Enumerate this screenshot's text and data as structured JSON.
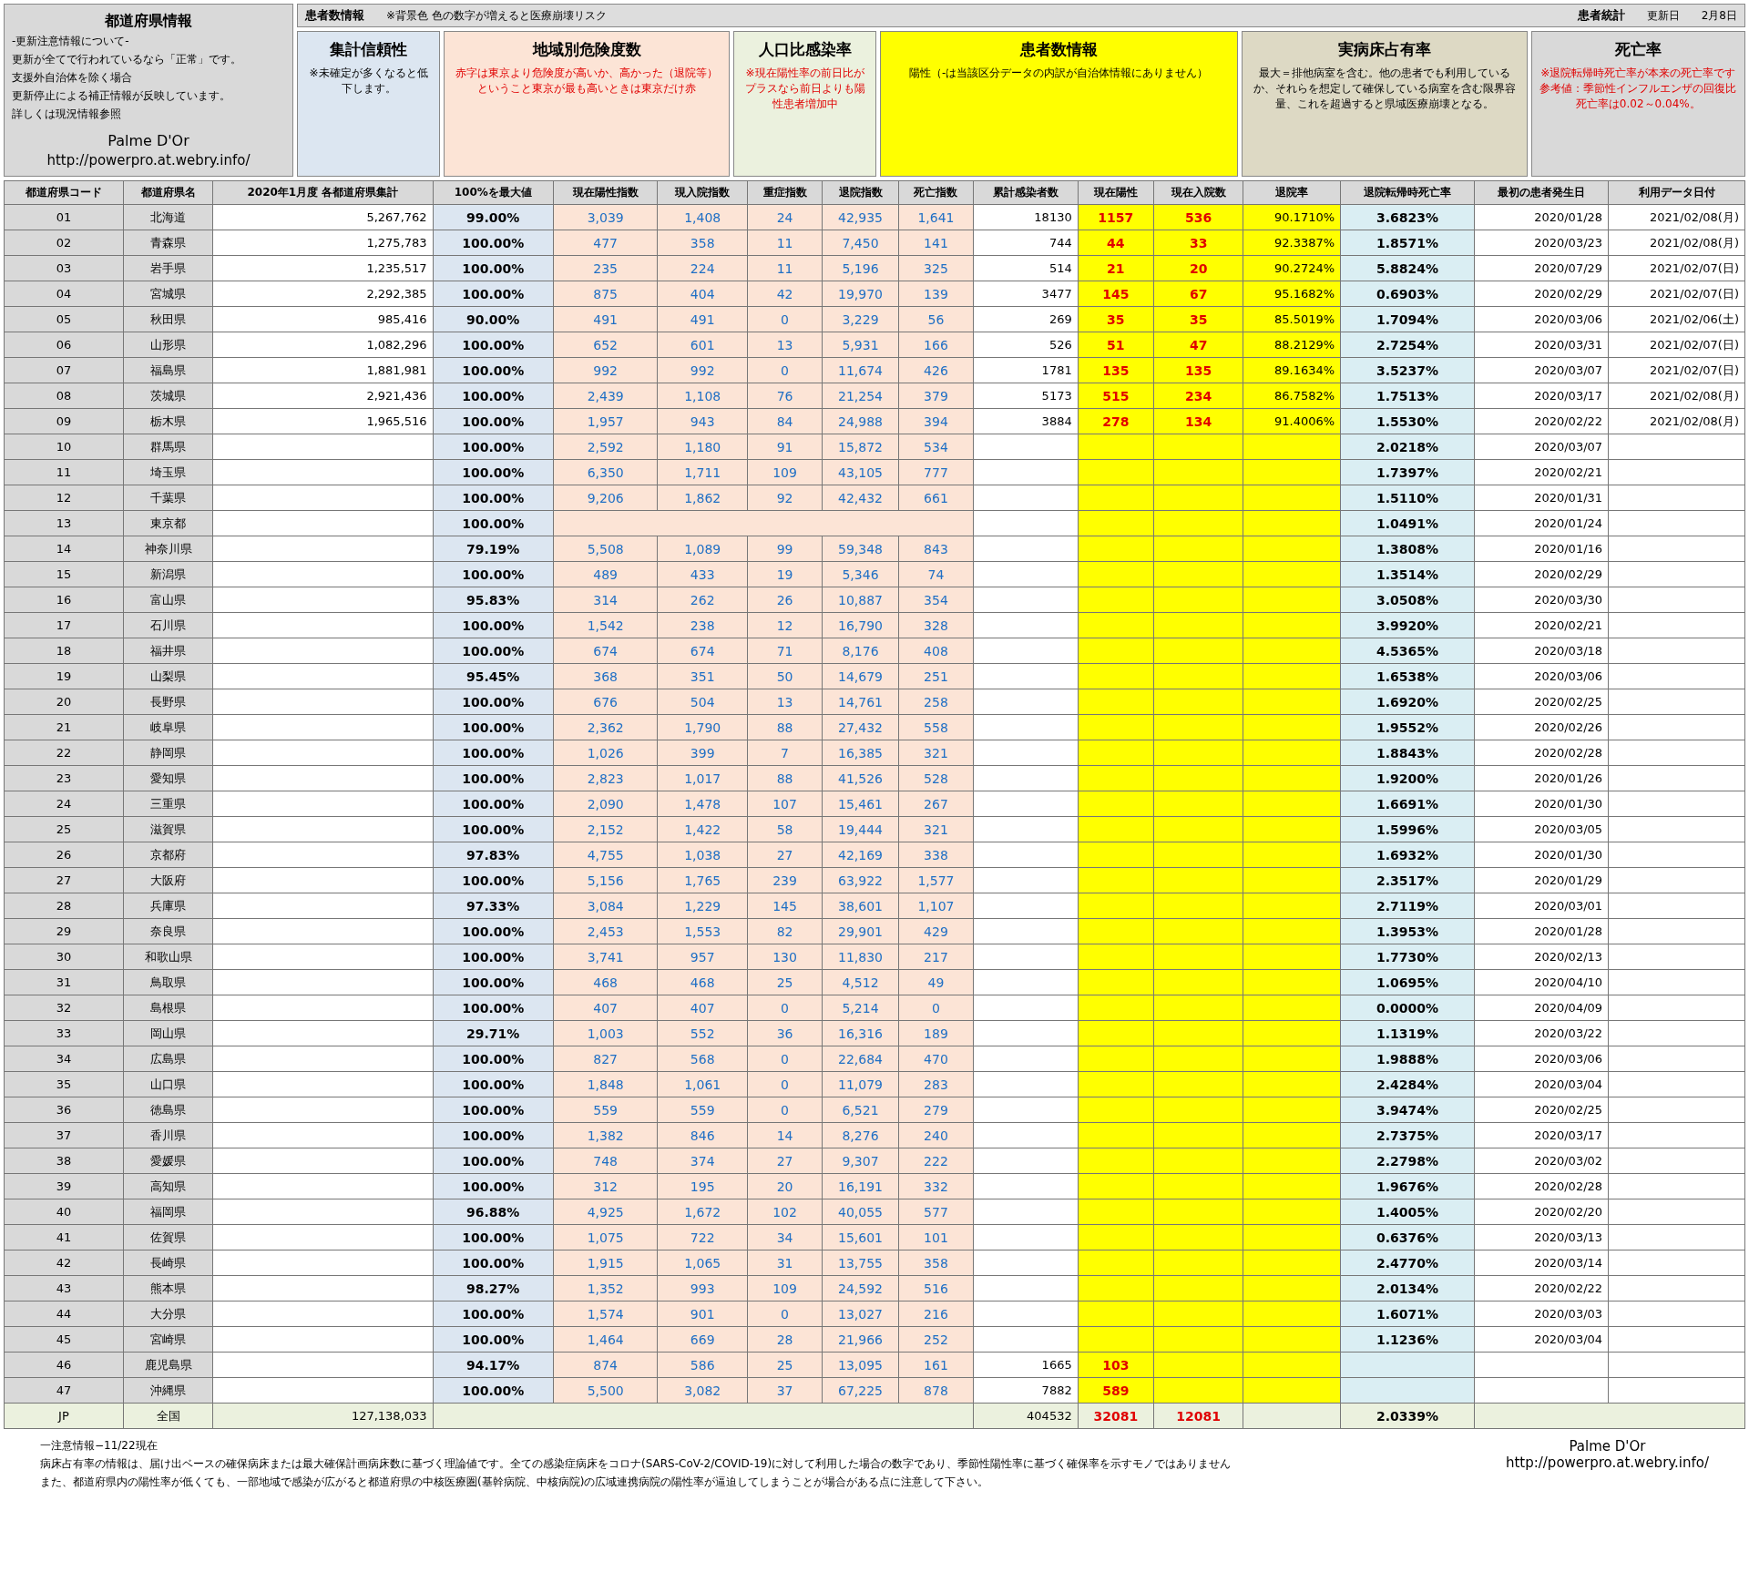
{
  "header": {
    "left_title": "都道府県情報",
    "notes": [
      "-更新注意情報について-",
      "更新が全てで行われているなら「正常」です。",
      "支援外自治体を除く場合",
      "更新停止による補正情報が反映しています。",
      "詳しくは現況情報参照"
    ],
    "brand": "Palme D'Or",
    "url": "http://powerpro.at.webry.info/",
    "center_title": "患者数情報",
    "center_note": "※背景色 色の数字が増えると医療崩壊リスク",
    "right_title": "患者統計",
    "update_label": "更新日",
    "update_date": "2月8日"
  },
  "groups": [
    {
      "label": "集計信頼性",
      "note": "※未確定が多くなると低下します。"
    },
    {
      "label": "地域別危険度数",
      "note": "赤字は東京より危険度が高いか、高かった（退院等）ということ東京が最も高いときは東京だけ赤"
    },
    {
      "label": "人口比感染率",
      "note": "※現在陽性率の前日比がプラスなら前日よりも陽性患者増加中"
    },
    {
      "label": "患者数情報",
      "note": "陽性（-は当該区分データの内訳が自治体情報にありません）"
    },
    {
      "label": "実病床占有率",
      "note": "最大＝排他病室を含む。他の患者でも利用しているか、それらを想定して確保している病室を含む限界容量、これを超過すると県域医療崩壊となる。"
    },
    {
      "label": "死亡率",
      "note": "※退院転帰時死亡率が本来の死亡率です参考値：季節性インフルエンザの回復比死亡率は0.02～0.04%。"
    }
  ],
  "columns": [
    "都道府県コード",
    "都道府県名",
    "2020年1月度 各都道府県集計",
    "100%を最大値",
    "現在陽性指数",
    "現入院指数",
    "重症指数",
    "退院指数",
    "死亡指数",
    "累計感染者数",
    "現在陽性",
    "現在入院数",
    "退院率",
    "退院転帰時死亡率",
    "最初の患者発生日",
    "利用データ日付"
  ],
  "rows": [
    {
      "code": "01",
      "name": "北海道",
      "population": "5,267,762",
      "reliability": "99.00%",
      "indices": [
        "3,039",
        "1,408",
        "24",
        "42,935",
        "1,641"
      ],
      "cumulative": "18130",
      "positive": "1157",
      "hospitalized": "536",
      "discharge_rate": "90.1710%",
      "death_rate": "3.6823%",
      "first_case": "2020/01/28",
      "data_date": "2021/02/08(月)"
    },
    {
      "code": "02",
      "name": "青森県",
      "population": "1,275,783",
      "reliability": "100.00%",
      "indices": [
        "477",
        "358",
        "11",
        "7,450",
        "141"
      ],
      "cumulative": "744",
      "positive": "44",
      "hospitalized": "33",
      "discharge_rate": "92.3387%",
      "death_rate": "1.8571%",
      "first_case": "2020/03/23",
      "data_date": "2021/02/08(月)"
    },
    {
      "code": "03",
      "name": "岩手県",
      "population": "1,235,517",
      "reliability": "100.00%",
      "indices": [
        "235",
        "224",
        "11",
        "5,196",
        "325"
      ],
      "cumulative": "514",
      "positive": "21",
      "hospitalized": "20",
      "discharge_rate": "90.2724%",
      "death_rate": "5.8824%",
      "first_case": "2020/07/29",
      "data_date": "2021/02/07(日)"
    },
    {
      "code": "04",
      "name": "宮城県",
      "population": "2,292,385",
      "reliability": "100.00%",
      "indices": [
        "875",
        "404",
        "42",
        "19,970",
        "139"
      ],
      "cumulative": "3477",
      "positive": "145",
      "hospitalized": "67",
      "discharge_rate": "95.1682%",
      "death_rate": "0.6903%",
      "first_case": "2020/02/29",
      "data_date": "2021/02/07(日)"
    },
    {
      "code": "05",
      "name": "秋田県",
      "population": "985,416",
      "reliability": "90.00%",
      "indices": [
        "491",
        "491",
        "0",
        "3,229",
        "56"
      ],
      "cumulative": "269",
      "positive": "35",
      "hospitalized": "35",
      "discharge_rate": "85.5019%",
      "death_rate": "1.7094%",
      "first_case": "2020/03/06",
      "data_date": "2021/02/06(土)"
    },
    {
      "code": "06",
      "name": "山形県",
      "population": "1,082,296",
      "reliability": "100.00%",
      "indices": [
        "652",
        "601",
        "13",
        "5,931",
        "166"
      ],
      "cumulative": "526",
      "positive": "51",
      "hospitalized": "47",
      "discharge_rate": "88.2129%",
      "death_rate": "2.7254%",
      "first_case": "2020/03/31",
      "data_date": "2021/02/07(日)"
    },
    {
      "code": "07",
      "name": "福島県",
      "population": "1,881,981",
      "reliability": "100.00%",
      "indices": [
        "992",
        "992",
        "0",
        "11,674",
        "426"
      ],
      "cumulative": "1781",
      "positive": "135",
      "hospitalized": "135",
      "discharge_rate": "89.1634%",
      "death_rate": "3.5237%",
      "first_case": "2020/03/07",
      "data_date": "2021/02/07(日)"
    },
    {
      "code": "08",
      "name": "茨城県",
      "population": "2,921,436",
      "reliability": "100.00%",
      "indices": [
        "2,439",
        "1,108",
        "76",
        "21,254",
        "379"
      ],
      "cumulative": "5173",
      "positive": "515",
      "hospitalized": "234",
      "discharge_rate": "86.7582%",
      "death_rate": "1.7513%",
      "first_case": "2020/03/17",
      "data_date": "2021/02/08(月)"
    },
    {
      "code": "09",
      "name": "栃木県",
      "population": "1,965,516",
      "reliability": "100.00%",
      "indices": [
        "1,957",
        "943",
        "84",
        "24,988",
        "394"
      ],
      "cumulative": "3884",
      "positive": "278",
      "hospitalized": "134",
      "discharge_rate": "91.4006%",
      "death_rate": "1.5530%",
      "first_case": "2020/02/22",
      "data_date": "2021/02/08(月)"
    },
    {
      "code": "10",
      "name": "群馬県",
      "reliability": "100.00%",
      "indices": [
        "2,592",
        "1,180",
        "91",
        "15,872",
        "534"
      ],
      "death_rate": "2.0218%",
      "first_case": "2020/03/07"
    },
    {
      "code": "11",
      "name": "埼玉県",
      "reliability": "100.00%",
      "indices": [
        "6,350",
        "1,711",
        "109",
        "43,105",
        "777"
      ],
      "death_rate": "1.7397%",
      "first_case": "2020/02/21"
    },
    {
      "code": "12",
      "name": "千葉県",
      "reliability": "100.00%",
      "indices": [
        "9,206",
        "1,862",
        "92",
        "42,432",
        "661"
      ],
      "death_rate": "1.5110%",
      "first_case": "2020/01/31"
    },
    {
      "code": "13",
      "name": "東京都",
      "reliability": "100.00%",
      "death_rate": "1.0491%",
      "first_case": "2020/01/24"
    },
    {
      "code": "14",
      "name": "神奈川県",
      "reliability": "79.19%",
      "indices": [
        "5,508",
        "1,089",
        "99",
        "59,348",
        "843"
      ],
      "death_rate": "1.3808%",
      "first_case": "2020/01/16"
    },
    {
      "code": "15",
      "name": "新潟県",
      "reliability": "100.00%",
      "indices": [
        "489",
        "433",
        "19",
        "5,346",
        "74"
      ],
      "death_rate": "1.3514%",
      "first_case": "2020/02/29"
    },
    {
      "code": "16",
      "name": "富山県",
      "reliability": "95.83%",
      "indices": [
        "314",
        "262",
        "26",
        "10,887",
        "354"
      ],
      "death_rate": "3.0508%",
      "first_case": "2020/03/30"
    },
    {
      "code": "17",
      "name": "石川県",
      "reliability": "100.00%",
      "indices": [
        "1,542",
        "238",
        "12",
        "16,790",
        "328"
      ],
      "death_rate": "3.9920%",
      "first_case": "2020/02/21"
    },
    {
      "code": "18",
      "name": "福井県",
      "reliability": "100.00%",
      "indices": [
        "674",
        "674",
        "71",
        "8,176",
        "408"
      ],
      "death_rate": "4.5365%",
      "first_case": "2020/03/18"
    },
    {
      "code": "19",
      "name": "山梨県",
      "reliability": "95.45%",
      "indices": [
        "368",
        "351",
        "50",
        "14,679",
        "251"
      ],
      "death_rate": "1.6538%",
      "first_case": "2020/03/06"
    },
    {
      "code": "20",
      "name": "長野県",
      "reliability": "100.00%",
      "indices": [
        "676",
        "504",
        "13",
        "14,761",
        "258"
      ],
      "death_rate": "1.6920%",
      "first_case": "2020/02/25"
    },
    {
      "code": "21",
      "name": "岐阜県",
      "reliability": "100.00%",
      "indices": [
        "2,362",
        "1,790",
        "88",
        "27,432",
        "558"
      ],
      "death_rate": "1.9552%",
      "first_case": "2020/02/26"
    },
    {
      "code": "22",
      "name": "静岡県",
      "reliability": "100.00%",
      "indices": [
        "1,026",
        "399",
        "7",
        "16,385",
        "321"
      ],
      "death_rate": "1.8843%",
      "first_case": "2020/02/28"
    },
    {
      "code": "23",
      "name": "愛知県",
      "reliability": "100.00%",
      "indices": [
        "2,823",
        "1,017",
        "88",
        "41,526",
        "528"
      ],
      "death_rate": "1.9200%",
      "first_case": "2020/01/26"
    },
    {
      "code": "24",
      "name": "三重県",
      "reliability": "100.00%",
      "indices": [
        "2,090",
        "1,478",
        "107",
        "15,461",
        "267"
      ],
      "death_rate": "1.6691%",
      "first_case": "2020/01/30"
    },
    {
      "code": "25",
      "name": "滋賀県",
      "reliability": "100.00%",
      "indices": [
        "2,152",
        "1,422",
        "58",
        "19,444",
        "321"
      ],
      "death_rate": "1.5996%",
      "first_case": "2020/03/05"
    },
    {
      "code": "26",
      "name": "京都府",
      "reliability": "97.83%",
      "indices": [
        "4,755",
        "1,038",
        "27",
        "42,169",
        "338"
      ],
      "death_rate": "1.6932%",
      "first_case": "2020/01/30"
    },
    {
      "code": "27",
      "name": "大阪府",
      "reliability": "100.00%",
      "indices": [
        "5,156",
        "1,765",
        "239",
        "63,922",
        "1,577"
      ],
      "death_rate": "2.3517%",
      "first_case": "2020/01/29"
    },
    {
      "code": "28",
      "name": "兵庫県",
      "reliability": "97.33%",
      "indices": [
        "3,084",
        "1,229",
        "145",
        "38,601",
        "1,107"
      ],
      "death_rate": "2.7119%",
      "first_case": "2020/03/01"
    },
    {
      "code": "29",
      "name": "奈良県",
      "reliability": "100.00%",
      "indices": [
        "2,453",
        "1,553",
        "82",
        "29,901",
        "429"
      ],
      "death_rate": "1.3953%",
      "first_case": "2020/01/28"
    },
    {
      "code": "30",
      "name": "和歌山県",
      "reliability": "100.00%",
      "indices": [
        "3,741",
        "957",
        "130",
        "11,830",
        "217"
      ],
      "death_rate": "1.7730%",
      "first_case": "2020/02/13"
    },
    {
      "code": "31",
      "name": "鳥取県",
      "reliability": "100.00%",
      "indices": [
        "468",
        "468",
        "25",
        "4,512",
        "49"
      ],
      "death_rate": "1.0695%",
      "first_case": "2020/04/10"
    },
    {
      "code": "32",
      "name": "島根県",
      "reliability": "100.00%",
      "indices": [
        "407",
        "407",
        "0",
        "5,214",
        "0"
      ],
      "death_rate": "0.0000%",
      "first_case": "2020/04/09"
    },
    {
      "code": "33",
      "name": "岡山県",
      "reliability": "29.71%",
      "indices": [
        "1,003",
        "552",
        "36",
        "16,316",
        "189"
      ],
      "death_rate": "1.1319%",
      "first_case": "2020/03/22"
    },
    {
      "code": "34",
      "name": "広島県",
      "reliability": "100.00%",
      "indices": [
        "827",
        "568",
        "0",
        "22,684",
        "470"
      ],
      "death_rate": "1.9888%",
      "first_case": "2020/03/06"
    },
    {
      "code": "35",
      "name": "山口県",
      "reliability": "100.00%",
      "indices": [
        "1,848",
        "1,061",
        "0",
        "11,079",
        "283"
      ],
      "death_rate": "2.4284%",
      "first_case": "2020/03/04"
    },
    {
      "code": "36",
      "name": "徳島県",
      "reliability": "100.00%",
      "indices": [
        "559",
        "559",
        "0",
        "6,521",
        "279"
      ],
      "death_rate": "3.9474%",
      "first_case": "2020/02/25"
    },
    {
      "code": "37",
      "name": "香川県",
      "reliability": "100.00%",
      "indices": [
        "1,382",
        "846",
        "14",
        "8,276",
        "240"
      ],
      "death_rate": "2.7375%",
      "first_case": "2020/03/17"
    },
    {
      "code": "38",
      "name": "愛媛県",
      "reliability": "100.00%",
      "indices": [
        "748",
        "374",
        "27",
        "9,307",
        "222"
      ],
      "death_rate": "2.2798%",
      "first_case": "2020/03/02"
    },
    {
      "code": "39",
      "name": "高知県",
      "reliability": "100.00%",
      "indices": [
        "312",
        "195",
        "20",
        "16,191",
        "332"
      ],
      "death_rate": "1.9676%",
      "first_case": "2020/02/28"
    },
    {
      "code": "40",
      "name": "福岡県",
      "reliability": "96.88%",
      "indices": [
        "4,925",
        "1,672",
        "102",
        "40,055",
        "577"
      ],
      "death_rate": "1.4005%",
      "first_case": "2020/02/20"
    },
    {
      "code": "41",
      "name": "佐賀県",
      "reliability": "100.00%",
      "indices": [
        "1,075",
        "722",
        "34",
        "15,601",
        "101"
      ],
      "death_rate": "0.6376%",
      "first_case": "2020/03/13"
    },
    {
      "code": "42",
      "name": "長崎県",
      "reliability": "100.00%",
      "indices": [
        "1,915",
        "1,065",
        "31",
        "13,755",
        "358"
      ],
      "death_rate": "2.4770%",
      "first_case": "2020/03/14"
    },
    {
      "code": "43",
      "name": "熊本県",
      "reliability": "98.27%",
      "indices": [
        "1,352",
        "993",
        "109",
        "24,592",
        "516"
      ],
      "death_rate": "2.0134%",
      "first_case": "2020/02/22"
    },
    {
      "code": "44",
      "name": "大分県",
      "reliability": "100.00%",
      "indices": [
        "1,574",
        "901",
        "0",
        "13,027",
        "216"
      ],
      "death_rate": "1.6071%",
      "first_case": "2020/03/03"
    },
    {
      "code": "45",
      "name": "宮崎県",
      "reliability": "100.00%",
      "indices": [
        "1,464",
        "669",
        "28",
        "21,966",
        "252"
      ],
      "death_rate": "1.1236%",
      "first_case": "2020/03/04"
    },
    {
      "code": "46",
      "name": "鹿児島県",
      "reliability": "94.17%",
      "indices": [
        "874",
        "586",
        "25",
        "13,095",
        "161"
      ],
      "cumulative": "1665",
      "positive": "103"
    },
    {
      "code": "47",
      "name": "沖縄県",
      "reliability": "100.00%",
      "indices": [
        "5,500",
        "3,082",
        "37",
        "67,225",
        "878"
      ],
      "cumulative": "7882",
      "positive": "589"
    }
  ],
  "total": {
    "code": "JP",
    "name": "全国",
    "population": "127,138,033",
    "cumulative": "404532",
    "positive": "32081",
    "hospitalized": "12081",
    "death_rate": "2.0339%"
  },
  "footer": {
    "notes": [
      "一注意情報−11/22現在",
      "病床占有率の情報は、届け出ベースの確保病床または最大確保計画病床数に基づく理論値です。全ての感染症病床をコロナ(SARS-CoV-2/COVID-19)に対して利用した場合の数字であり、季節性陽性率に基づく確保率を示すモノではありません",
      "また、都道府県内の陽性率が低くても、一部地域で感染が広がると都道府県の中核医療圏(基幹病院、中核病院)の広域連携病院の陽性率が逼迫してしまうことが場合がある点に注意して下さい。"
    ],
    "brand": "Palme D'Or",
    "url": "http://powerpro.at.webry.info/"
  }
}
